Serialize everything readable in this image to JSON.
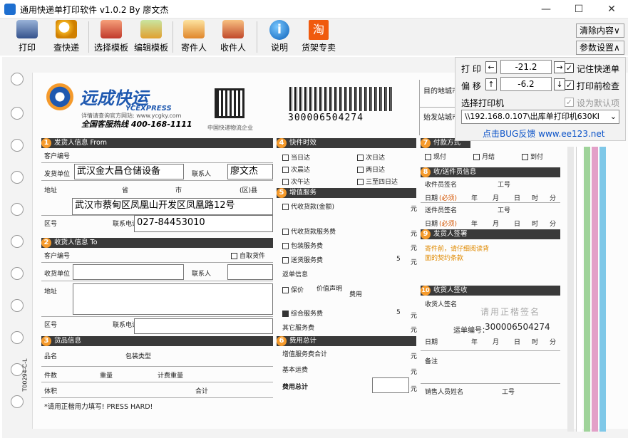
{
  "window": {
    "title": "通用快递单打印软件 v1.0.2 By 廖文杰",
    "minimize": "—",
    "maximize": "☐",
    "close": "✕"
  },
  "toolbar": {
    "print": "打印",
    "query": "查快递",
    "select_template": "选择模板",
    "edit_template": "编辑模板",
    "sender": "寄件人",
    "receiver": "收件人",
    "help": "说明",
    "shop": "货架专卖",
    "clear": "清除内容∨",
    "settings": "参数设置∧"
  },
  "panel": {
    "print_label": "打 印",
    "print_value": "-21.2",
    "offset_label": "偏 移",
    "offset_value": "-6.2",
    "remember": "记住快递单",
    "precheck": "打印前检查",
    "default": "设为默认项",
    "printer_label": "选择打印机",
    "printer_value": "\\\\192.168.0.107\\出库单打印机630KI",
    "bug_link": "点击BUG反馈 www.ee123.net"
  },
  "waybill": {
    "brand": "远成快运",
    "brand_en": "YCEXPRESS",
    "site": "详情请查询官方网站: www.ycgky.com",
    "hotline": "全国客服热线 400-168-1111",
    "qr_caption": "中国快递物流企业",
    "tracking_no": "300006504274",
    "origin_city": "始发站城市",
    "dest_city": "目的地城市",
    "sec1": "发货人信息 From",
    "sec2": "收货人信息 To",
    "sec3": "货品信息",
    "sec4": "快件时效",
    "sec5": "增值服务",
    "sec6": "费用总计",
    "sec7": "付款方式",
    "sec8": "收/送件员信息",
    "sec9": "发货人签署",
    "sec10": "收货人签收",
    "customer_no": "客户编号",
    "ship_unit": "发货单位",
    "contact": "联系人",
    "address": "地址",
    "province": "省",
    "city": "市",
    "district": "(区)县",
    "area_code": "区号",
    "phone": "联系电话",
    "self_pickup": "自取货件",
    "receive_unit": "收货单位",
    "goods_name": "品名",
    "package_type": "包装类型",
    "pieces": "件数",
    "weight": "重量",
    "charge_weight": "计费重量",
    "volume": "体积",
    "total": "合计",
    "t1": "当日达",
    "t2": "次日达",
    "t3": "次晨达",
    "t4": "两日达",
    "t5": "次午达",
    "t6": "三至四日达",
    "v1": "代收货款(金额)",
    "v2": "代收货款服务费",
    "v3": "包装服务费",
    "v4": "送货服务费",
    "v5": "返单信息",
    "v6": "保价",
    "v7": "价值声明",
    "v8": "费用",
    "v9": "综合服务费",
    "v10": "其它服务费",
    "f1": "增值服务费合计",
    "f2": "基本运费",
    "f3": "费用总计",
    "yuan": "元",
    "five": "5",
    "p1": "现付",
    "p2": "月结",
    "p3": "到付",
    "pickup_sign": "收件员签名",
    "deliver_sign": "送件员签名",
    "job_no": "工号",
    "date": "日期",
    "year": "年",
    "month": "月",
    "day": "日",
    "hour": "时",
    "minute": "分",
    "required": "(必须)",
    "shipper_note": "寄件前，请仔细阅读背面的契约条款",
    "recv_sign": "收货人签名",
    "recv_hint": "请用正楷签名",
    "waybill_label": "运单编号：",
    "remark": "备注",
    "sales": "销售人员姓名",
    "press_hard": "*请用正楷用力填写! PRESS HARD!",
    "form_code": "T00294-C-L"
  },
  "filled": {
    "ship_unit": "武汉金大昌仓储设备",
    "contact": "廖文杰",
    "address": "武汉市蔡甸区凤凰山开发区凤凰路12号",
    "phone": "027-84453010",
    "waybill_no": "300006504274"
  }
}
